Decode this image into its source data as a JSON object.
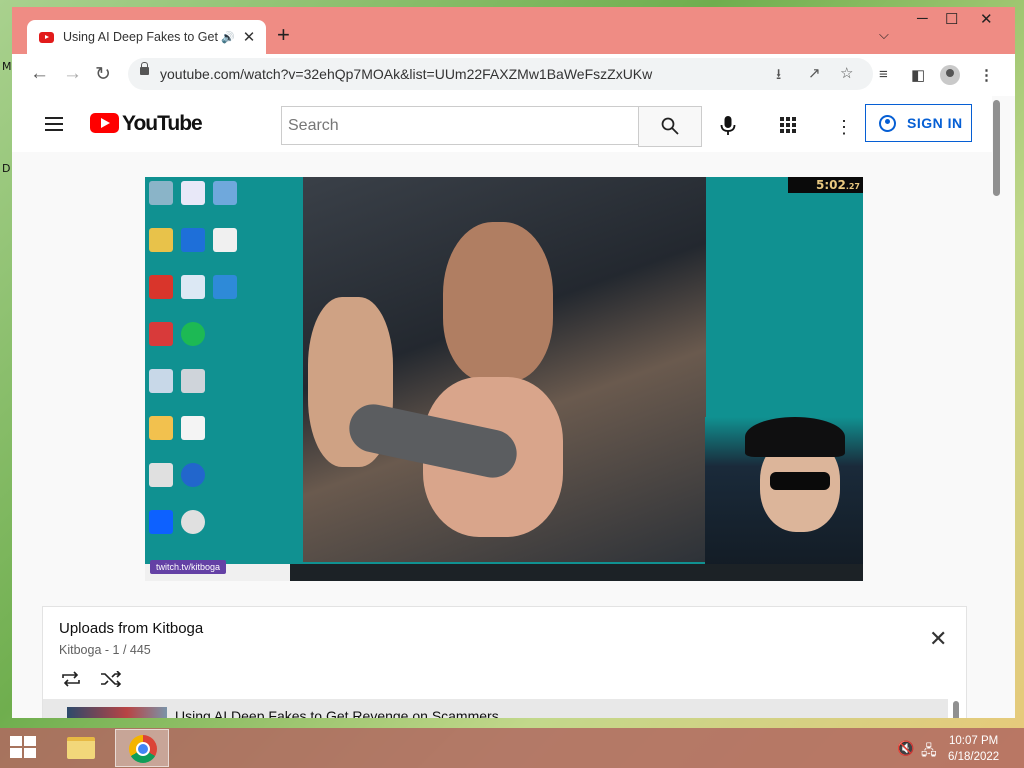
{
  "desktop": {
    "label_m": "M",
    "label_d": "D"
  },
  "browser": {
    "tab": {
      "title": "Using AI Deep Fakes to Get R",
      "audio_icon": "speaker-icon",
      "close": "✕"
    },
    "new_tab": "+",
    "window_controls": {
      "minimize": "─",
      "maximize": "☐",
      "close": "✕"
    },
    "url": "youtube.com/watch?v=32ehQp7MOAk&list=UUm22FAXZMw1BaWeFszZxUKw"
  },
  "youtube": {
    "logo_text": "YouTube",
    "search_placeholder": "Search",
    "sign_in": "SIGN IN"
  },
  "video": {
    "timer": "5:02",
    "timer_ms": ".27",
    "twitch_label": "twitch.tv/kitboga"
  },
  "playlist": {
    "title": "Uploads from Kitboga",
    "channel": "Kitboga",
    "position": "1 / 445",
    "items": [
      {
        "title": "Using AI Deep Fakes to Get Revenge on Scammers"
      }
    ]
  },
  "taskbar": {
    "time": "10:07 PM",
    "date": "6/18/2022"
  },
  "colors": {
    "yt_red": "#ff0000",
    "signin_blue": "#065fd4",
    "chrome_frame": "#ef8c84",
    "video_teal": "#109191"
  }
}
